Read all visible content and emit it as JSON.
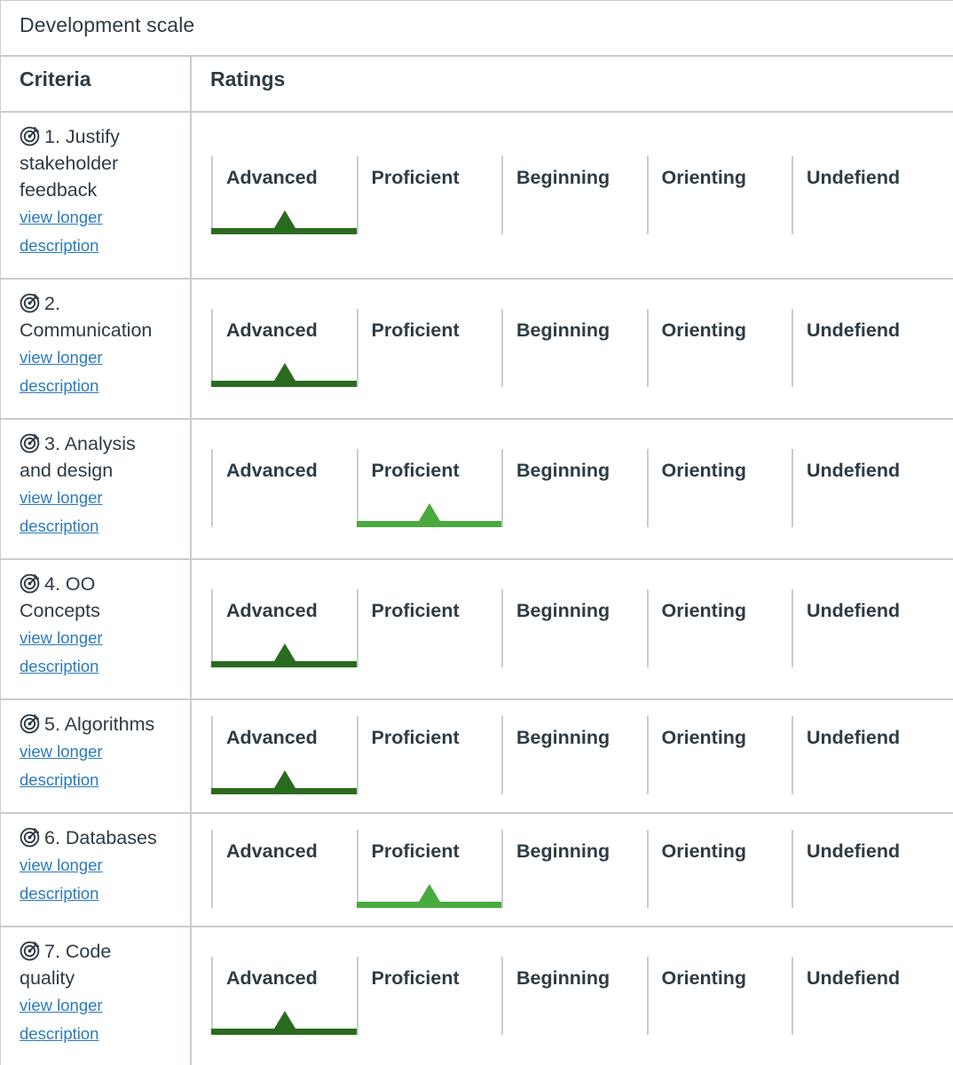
{
  "rubric": {
    "title": "Development scale",
    "headers": {
      "criteria": "Criteria",
      "ratings": "Ratings"
    },
    "link_text_line1": "view longer",
    "link_text_line2": "description",
    "rating_labels": [
      "Advanced",
      "Proficient",
      "Beginning",
      "Orienting",
      "Undefiend"
    ],
    "colors": {
      "advanced_selected": "#2a6b1f",
      "proficient_selected": "#4aaa3f"
    },
    "criteria": [
      {
        "lines": [
          "1. Justify",
          "stakeholder",
          "feedback"
        ],
        "selected_rating": "Advanced"
      },
      {
        "lines": [
          "2.",
          "Communication"
        ],
        "selected_rating": "Advanced"
      },
      {
        "lines": [
          "3. Analysis",
          "and design"
        ],
        "selected_rating": "Proficient"
      },
      {
        "lines": [
          "4. OO",
          "Concepts"
        ],
        "selected_rating": "Advanced"
      },
      {
        "lines": [
          "5. Algorithms"
        ],
        "selected_rating": "Advanced"
      },
      {
        "lines": [
          "6. Databases"
        ],
        "selected_rating": "Proficient"
      },
      {
        "lines": [
          "7. Code",
          "quality"
        ],
        "selected_rating": "Advanced"
      }
    ]
  }
}
